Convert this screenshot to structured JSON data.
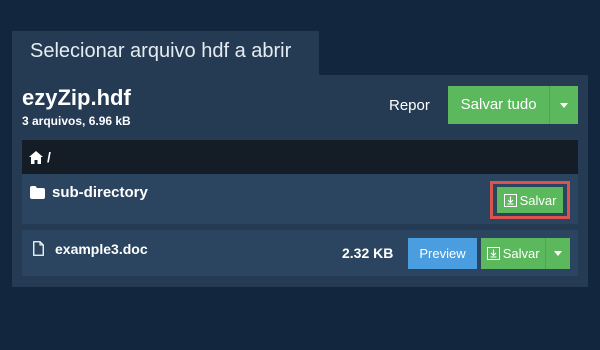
{
  "dialog": {
    "title": "Selecionar arquivo hdf a abrir"
  },
  "archive": {
    "name": "ezyZip.hdf",
    "summary": "3 arquivos, 6.96 kB",
    "reset_label": "Repor",
    "save_all_label": "Salvar tudo"
  },
  "breadcrumb": {
    "path": "/",
    "icon": "home-icon"
  },
  "entries": [
    {
      "type": "directory",
      "icon": "folder-icon",
      "name": "sub-directory",
      "save_label": "Salvar",
      "highlighted": true
    },
    {
      "type": "file",
      "icon": "file-icon",
      "name": "example3.doc",
      "size": "2.32 KB",
      "preview_label": "Preview",
      "save_label": "Salvar"
    }
  ],
  "colors": {
    "background": "#12263d",
    "panel": "#243b53",
    "row": "#2b4560",
    "success": "#5cb85c",
    "info": "#4a9edf",
    "highlight": "#d9534f"
  }
}
